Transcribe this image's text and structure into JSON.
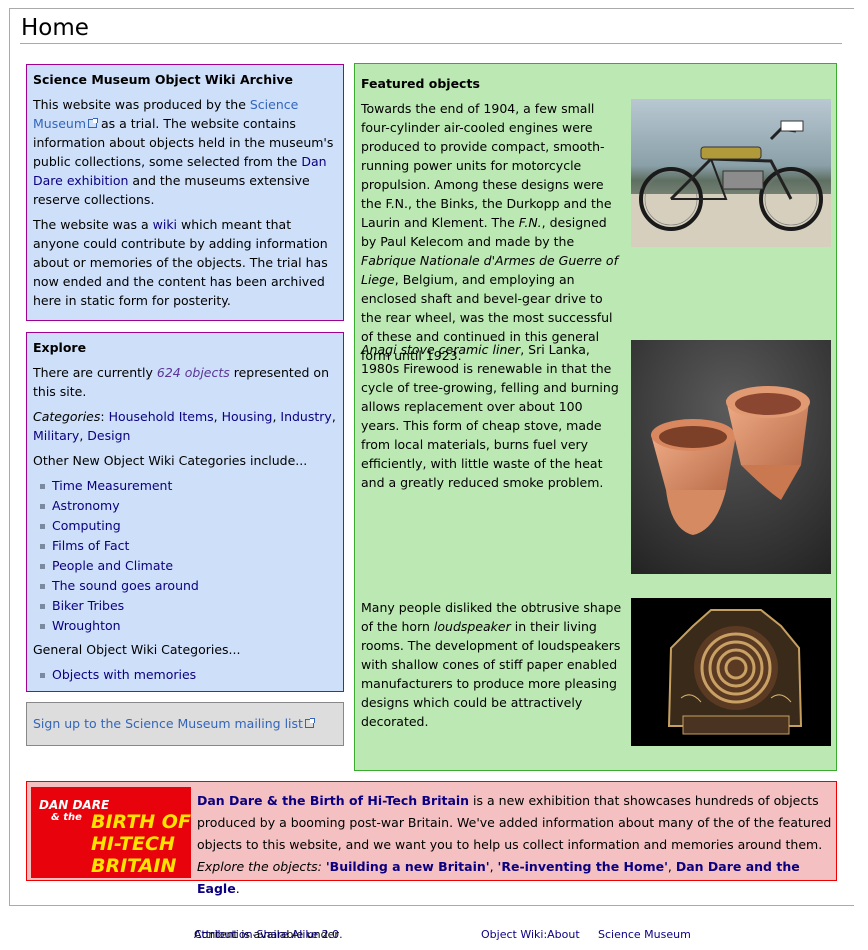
{
  "page": {
    "title": "Home"
  },
  "archive": {
    "heading": "Science Museum Object Wiki Archive",
    "p1_before": "This website was produced by the ",
    "p1_link": "Science Museum",
    "p1_mid": " as a trial. The website contains information about objects held in the museum's public collections, some selected from the ",
    "p1_link2": "Dan Dare exhibition",
    "p1_after": " and the museums extensive reserve collections.",
    "p2_before": "The website was a ",
    "p2_link": "wiki",
    "p2_after": " which meant that anyone could contribute by adding information about or memories of the objects. The trial has now ended and the content has been archived here in static form for posterity."
  },
  "explore": {
    "heading": "Explore",
    "count_before": "There are currently ",
    "count_link": "624 objects",
    "count_after": " represented on this site.",
    "categories_label": "Categories",
    "categories": [
      "Household Items",
      "Housing",
      "Industry",
      "Military",
      "Design"
    ],
    "other_label": "Other New Object Wiki Categories include...",
    "other_items": [
      "Time Measurement",
      "Astronomy",
      "Computing",
      "Films of Fact",
      "People and Climate",
      "The sound goes around",
      "Biker Tribes",
      "Wroughton"
    ],
    "general_label": "General Object Wiki Categories...",
    "general_items": [
      "Objects with memories"
    ]
  },
  "mailing": {
    "link": "Sign up to the Science Museum mailing list"
  },
  "featured": {
    "heading": "Featured objects",
    "item1": {
      "t1": "Towards the end of 1904, a few small four-cylinder air-cooled engines were produced to provide compact, smooth-running power units for motorcycle propulsion. Among these designs were the F.N., the Binks, the Durkopp and the Laurin and Klement. The ",
      "t2": "F.N.",
      "t3": ", designed by Paul Kelecom and made by the ",
      "t4": "Fabrique Nationale d'Armes de Guerre of Liege",
      "t5": ", Belgium, and employing an enclosed shaft and bevel-gear drive to the rear wheel, was the most successful of these and continued in this general form until 1923."
    },
    "item2": {
      "t1": "Anagi stove ceramic liner",
      "t2": ", Sri Lanka, 1980s Firewood is renewable in that the cycle of tree-growing, felling and burning allows replacement over about 100 years. This form of cheap stove, made from local materials, burns fuel very efficiently, with little waste of the heat and a greatly reduced smoke problem."
    },
    "item3": {
      "t1": "Many people disliked the obtrusive shape of the horn ",
      "t2": "loudspeaker",
      "t3": " in their living rooms. The development of loudspeakers with shallow cones of stiff paper enabled manufacturers to produce more pleasing designs which could be attractively decorated."
    }
  },
  "dandare": {
    "logo_line1": "DAN DARE",
    "logo_line2": "& the",
    "logo_line3": "BIRTH OF",
    "logo_line4": "HI-TECH",
    "logo_line5": "BRITAIN",
    "link": "Dan Dare & the Birth of Hi-Tech Britain",
    "text": " is a new exhibition that showcases hundreds of objects produced by a booming post-war Britain. We've added information about many of the of the featured objects to this website, and we want you to help us collect information and memories around them.",
    "explore_label": "Explore the objects: ",
    "links": [
      "'Building a new Britain'",
      "'Re-inventing the Home'",
      "Dan Dare and the Eagle"
    ],
    "sep": ", ",
    "end": "."
  },
  "footer": {
    "license_prefix": "Content is available under ",
    "license_link": "Attribution-Share Alike 2.0.",
    "about": "Object Wiki:About",
    "museum": "Science Museum"
  }
}
